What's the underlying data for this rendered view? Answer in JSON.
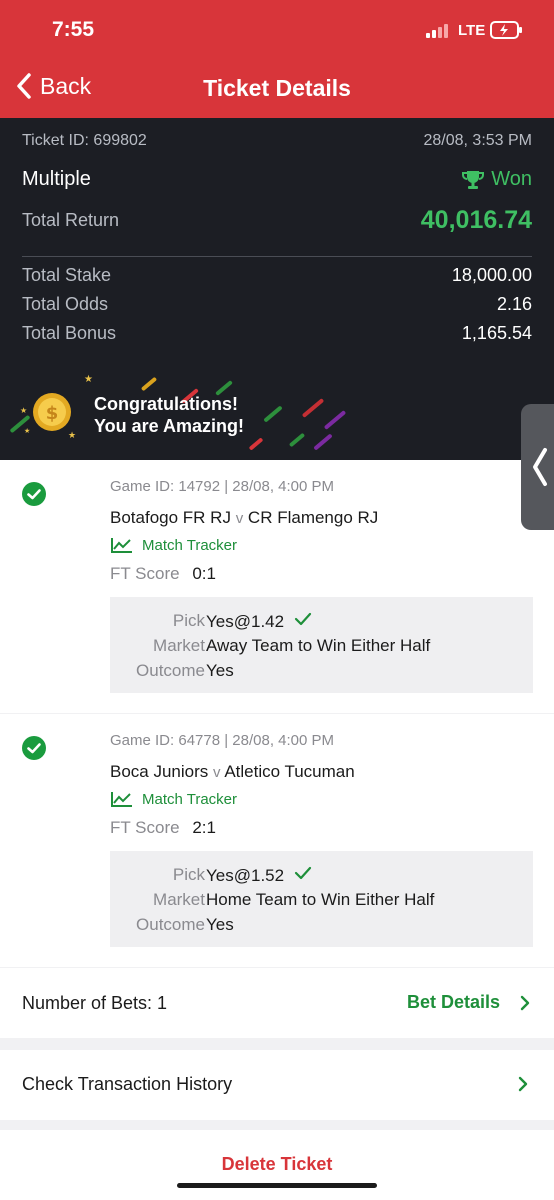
{
  "status_bar": {
    "time": "7:55",
    "network": "LTE"
  },
  "nav": {
    "back_label": "Back",
    "title": "Ticket Details"
  },
  "summary": {
    "ticket_id": "Ticket ID: 699802",
    "datetime": "28/08, 3:53 PM",
    "type": "Multiple",
    "status": "Won",
    "total_return_label": "Total Return",
    "total_return": "40,016.74",
    "total_stake_label": "Total Stake",
    "total_stake": "18,000.00",
    "total_odds_label": "Total Odds",
    "total_odds": "2.16",
    "total_bonus_label": "Total Bonus",
    "total_bonus": "1,165.54",
    "banner_line1": "Congratulations!",
    "banner_line2": "You are Amazing!"
  },
  "bets": [
    {
      "game_id": "Game ID: 14792 |  28/08, 4:00 PM",
      "home": "Botafogo FR RJ",
      "vs": "v",
      "away": "CR Flamengo RJ",
      "tracker": "Match Tracker",
      "ft_label": "FT Score",
      "ft_score": "0:1",
      "pick_label": "Pick",
      "pick": "Yes@1.42",
      "market_label": "Market",
      "market": "Away Team to Win Either Half",
      "outcome_label": "Outcome",
      "outcome": "Yes"
    },
    {
      "game_id": "Game ID: 64778 |  28/08, 4:00 PM",
      "home": "Boca Juniors",
      "vs": "v",
      "away": "Atletico Tucuman",
      "tracker": "Match Tracker",
      "ft_label": "FT Score",
      "ft_score": "2:1",
      "pick_label": "Pick",
      "pick": "Yes@1.52",
      "market_label": "Market",
      "market": "Home Team to Win Either Half",
      "outcome_label": "Outcome",
      "outcome": "Yes"
    }
  ],
  "number_of_bets": "Number of Bets: 1",
  "bet_details_label": "Bet Details",
  "history_label": "Check Transaction History",
  "delete_label": "Delete Ticket",
  "colors": {
    "brand_red": "#d8353a",
    "won_green": "#3fbf63",
    "dark_bg": "#1c1e24"
  }
}
